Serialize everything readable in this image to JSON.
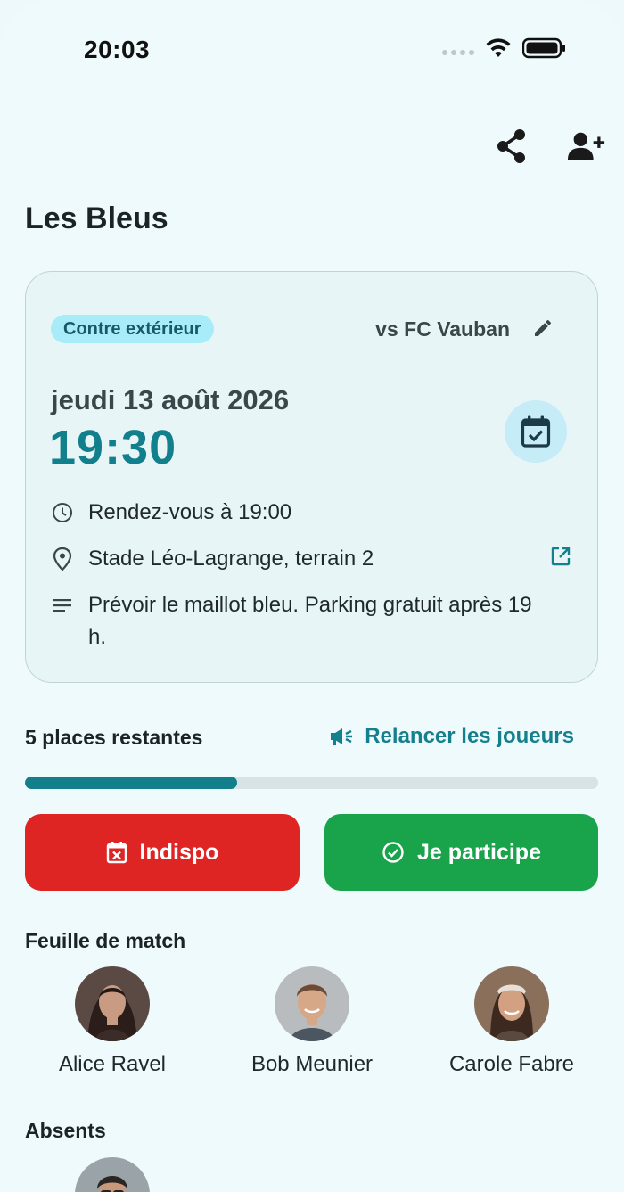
{
  "status_bar": {
    "time": "20:03"
  },
  "header": {
    "share_icon": "share-icon",
    "add_member_icon": "person-add-icon"
  },
  "team": {
    "name": "Les Bleus"
  },
  "event": {
    "badge": "Contre extérieur",
    "opponent": "vs FC Vauban",
    "date": "jeudi 13 août 2026",
    "time": "19:30",
    "meeting": "Rendez-vous à 19:00",
    "location": "Stade Léo-Lagrange, terrain 2",
    "note": "Prévoir le maillot bleu. Parking gratuit après 19 h."
  },
  "capacity": {
    "remaining_label": "5 places restantes",
    "remind_label": "Relancer les joueurs",
    "progress_fraction": 0.37
  },
  "actions": {
    "unavailable": "Indispo",
    "participate": "Je participe"
  },
  "lineup": {
    "title": "Feuille de match",
    "players": [
      {
        "name": "Alice Ravel"
      },
      {
        "name": "Bob Meunier"
      },
      {
        "name": "Carole Fabre"
      }
    ]
  },
  "absents": {
    "title": "Absents"
  },
  "colors": {
    "accent": "#117f8c",
    "danger": "#df2424",
    "success": "#19a34a",
    "badge_bg": "#a7ecf8",
    "background": "#eefafc"
  }
}
